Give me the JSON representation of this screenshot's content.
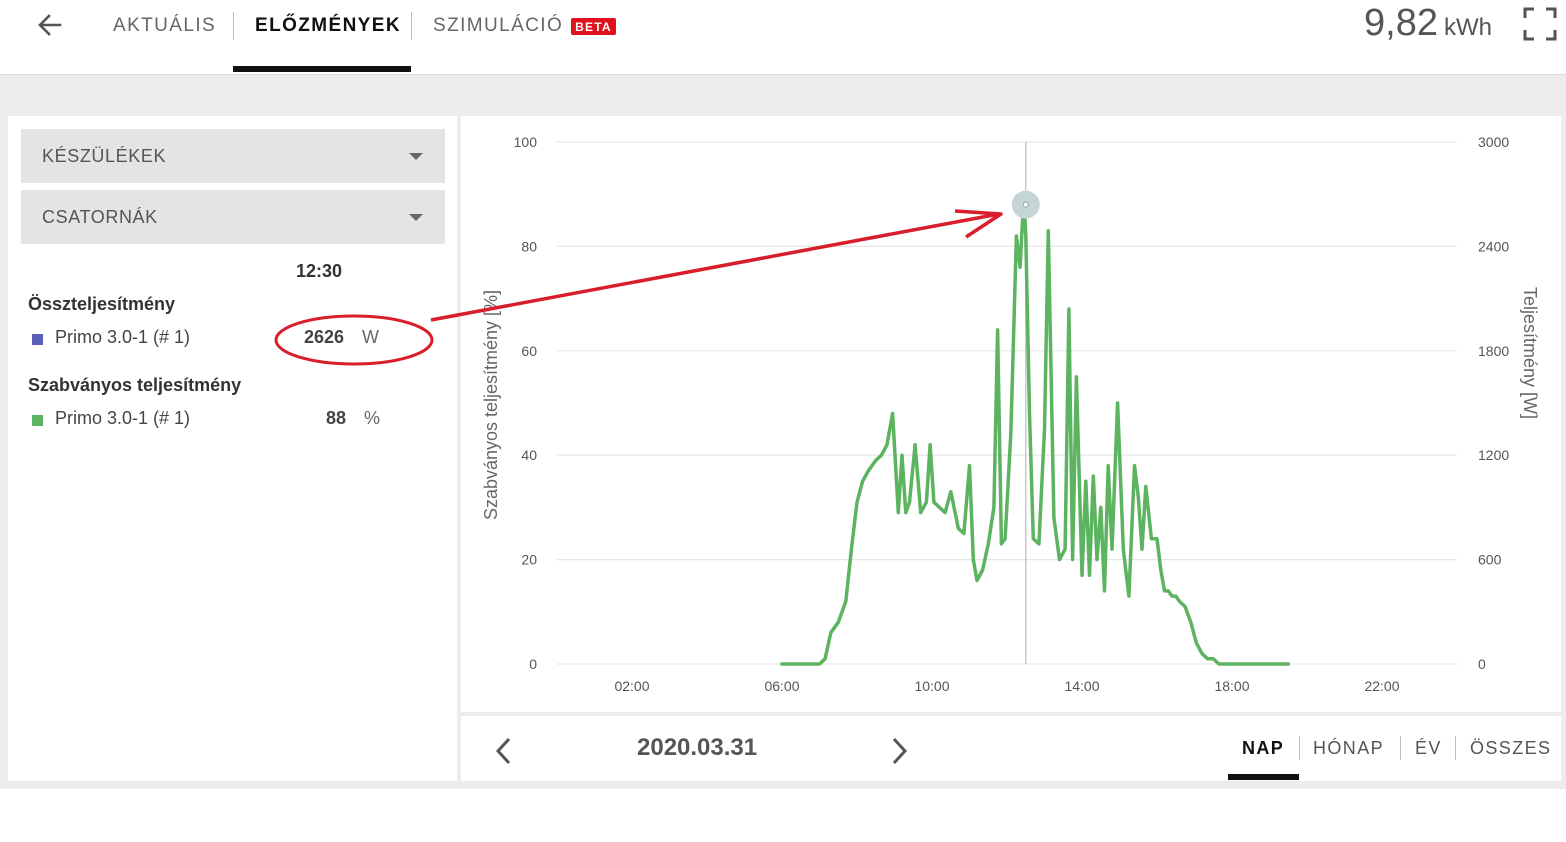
{
  "header": {
    "tabs": [
      {
        "label": "AKTUÁLIS",
        "active": false
      },
      {
        "label": "ELŐZMÉNYEK",
        "active": true
      },
      {
        "label": "SZIMULÁCIÓ",
        "active": false
      }
    ],
    "beta_badge": "BETA",
    "energy_value": "9,82",
    "energy_unit": "kWh",
    "icons": {
      "back": "arrow-left-icon",
      "fullscreen": "fullscreen-icon"
    }
  },
  "sidebar": {
    "devices_label": "KÉSZÜLÉKEK",
    "channels_label": "CSATORNÁK",
    "time": "12:30",
    "groups": [
      {
        "title": "Összteljesítmény",
        "items": [
          {
            "name": "Primo 3.0-1 (# 1)",
            "value": "2626",
            "unit": "W",
            "color": "#5b60b8"
          }
        ]
      },
      {
        "title": "Szabványos teljesítmény",
        "items": [
          {
            "name": "Primo 3.0-1 (# 1)",
            "value": "88",
            "unit": "%",
            "color": "#5cb360"
          }
        ]
      }
    ]
  },
  "navigation": {
    "date": "2020.03.31",
    "periods": [
      {
        "label": "NAP",
        "active": true
      },
      {
        "label": "HÓNAP",
        "active": false
      },
      {
        "label": "ÉV",
        "active": false
      },
      {
        "label": "ÖSSZES",
        "active": false
      }
    ]
  },
  "colors": {
    "series": "#5cb360",
    "annotation": "#d81e2a",
    "grid": "#e6e6e6"
  },
  "chart_data": {
    "type": "line",
    "ylabel": "Szabványos teljesítmény [%]",
    "y2label": "Teljesítmény [W]",
    "ylim": [
      0,
      100
    ],
    "y2lim": [
      0,
      3000
    ],
    "yticks": [
      0,
      20,
      40,
      60,
      80,
      100
    ],
    "y2ticks": [
      0,
      600,
      1200,
      1800,
      2400,
      3000
    ],
    "xticks": [
      "02:00",
      "06:00",
      "10:00",
      "14:00",
      "18:00",
      "22:00"
    ],
    "xlim_hours": [
      0,
      24
    ],
    "cursor_time": "12:30",
    "cursor_value": 88,
    "grid": true,
    "series": [
      {
        "name": "Primo 3.0-1 (# 1)",
        "color": "#5cb360",
        "x_hours": [
          6.0,
          7.0,
          7.15,
          7.3,
          7.5,
          7.7,
          7.85,
          8.0,
          8.15,
          8.3,
          8.5,
          8.65,
          8.8,
          8.95,
          9.1,
          9.2,
          9.3,
          9.4,
          9.55,
          9.7,
          9.85,
          9.95,
          10.05,
          10.2,
          10.35,
          10.5,
          10.7,
          10.85,
          11.0,
          11.1,
          11.2,
          11.35,
          11.5,
          11.65,
          11.75,
          11.85,
          11.95,
          12.1,
          12.25,
          12.35,
          12.45,
          12.5,
          12.6,
          12.7,
          12.85,
          13.0,
          13.1,
          13.25,
          13.4,
          13.55,
          13.65,
          13.75,
          13.85,
          14.0,
          14.1,
          14.2,
          14.3,
          14.4,
          14.5,
          14.6,
          14.7,
          14.8,
          14.95,
          15.1,
          15.25,
          15.4,
          15.5,
          15.6,
          15.7,
          15.85,
          16.0,
          16.1,
          16.2,
          16.3,
          16.4,
          16.5,
          16.6,
          16.75,
          16.9,
          17.05,
          17.2,
          17.35,
          17.5,
          17.65,
          17.8,
          18.0,
          18.2,
          18.4,
          18.6,
          18.8,
          19.0,
          19.2,
          19.5
        ],
        "values": [
          0,
          0,
          1,
          6,
          8,
          12,
          22,
          31,
          35,
          37,
          39,
          40,
          42,
          48,
          29,
          40,
          29,
          31,
          42,
          29,
          31,
          42,
          31,
          30,
          29,
          33,
          26,
          25,
          38,
          20,
          16,
          18,
          23,
          30,
          64,
          23,
          24,
          44,
          82,
          76,
          90,
          82,
          48,
          24,
          23,
          45,
          83,
          28,
          20,
          22,
          68,
          20,
          55,
          17,
          35,
          17,
          36,
          20,
          30,
          14,
          38,
          22,
          50,
          22,
          13,
          38,
          32,
          22,
          34,
          24,
          24,
          18,
          14,
          14,
          13,
          13,
          12,
          11,
          8,
          4,
          2,
          1,
          1,
          0,
          0,
          0,
          0,
          0,
          0,
          0,
          0,
          0,
          0
        ]
      }
    ]
  }
}
